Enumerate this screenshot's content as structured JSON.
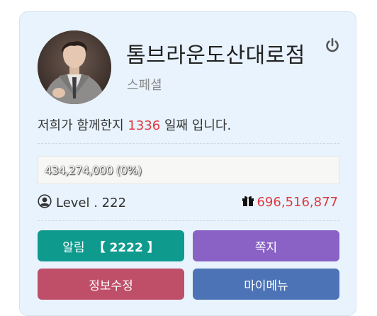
{
  "profile": {
    "shop_name": "톰브라운도산대로점",
    "subtitle": "스페셜",
    "days_prefix": "저희가 함께한지",
    "days_count": "1336",
    "days_suffix": "일째 입니다."
  },
  "progress": {
    "text": "434,274,000 (0%)",
    "fraction": 0
  },
  "level": {
    "text": "Level . 222"
  },
  "points": {
    "value": "696,516,877"
  },
  "buttons": {
    "alarm_label": "알림",
    "alarm_count": "【 2222 】",
    "memo_label": "쪽지",
    "edit_label": "정보수정",
    "menu_label": "마이메뉴"
  },
  "colors": {
    "card_bg": "#e8f3fd",
    "accent_red": "#e0383e",
    "alarm_btn": "#0f9a8e",
    "memo_btn": "#8a62c6",
    "edit_btn": "#bf4f69",
    "menu_btn": "#4b73b5"
  },
  "icons": [
    "power-icon",
    "user-circle-icon",
    "gift-icon"
  ]
}
